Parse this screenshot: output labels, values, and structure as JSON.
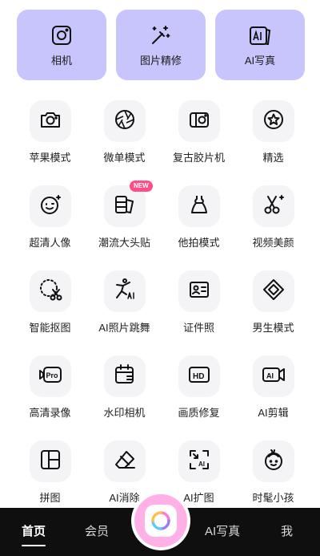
{
  "top_cards": [
    {
      "label": "相机",
      "icon": "camera-square-icon"
    },
    {
      "label": "图片精修",
      "icon": "magic-wand-icon"
    },
    {
      "label": "AI写真",
      "icon": "ai-portrait-icon"
    }
  ],
  "tools": [
    {
      "label": "苹果模式",
      "icon": "camera-icon"
    },
    {
      "label": "微单模式",
      "icon": "aperture-icon"
    },
    {
      "label": "复古胶片机",
      "icon": "film-camera-icon"
    },
    {
      "label": "精选",
      "icon": "star-badge-icon"
    },
    {
      "label": "超清人像",
      "icon": "smile-face-icon"
    },
    {
      "label": "潮流大头贴",
      "icon": "photo-sticker-icon",
      "badge": "NEW"
    },
    {
      "label": "他拍模式",
      "icon": "dress-icon"
    },
    {
      "label": "视频美颜",
      "icon": "scissors-sparkle-icon"
    },
    {
      "label": "智能抠图",
      "icon": "cutout-scissors-icon"
    },
    {
      "label": "AI照片跳舞",
      "icon": "dancer-ai-icon"
    },
    {
      "label": "证件照",
      "icon": "id-card-icon"
    },
    {
      "label": "男生模式",
      "icon": "diamond-icon"
    },
    {
      "label": "高清录像",
      "icon": "pro-video-icon"
    },
    {
      "label": "水印相机",
      "icon": "calendar-camera-icon"
    },
    {
      "label": "画质修复",
      "icon": "hd-icon"
    },
    {
      "label": "AI剪辑",
      "icon": "ai-video-clip-icon"
    },
    {
      "label": "拼图",
      "icon": "collage-icon"
    },
    {
      "label": "AI消除",
      "icon": "eraser-icon"
    },
    {
      "label": "AI扩图",
      "icon": "ai-expand-icon"
    },
    {
      "label": "时髦小孩",
      "icon": "kid-face-icon"
    }
  ],
  "nav": {
    "home": "首页",
    "vip": "会员",
    "ai_portrait": "AI写真",
    "me": "我"
  },
  "colors": {
    "card_bg": "#c8c4fc",
    "tile_bg": "#f4f4f6",
    "nav_bg": "#0f0f0f",
    "center_button": "#ffb0e6",
    "badge": "#ff4f86"
  }
}
